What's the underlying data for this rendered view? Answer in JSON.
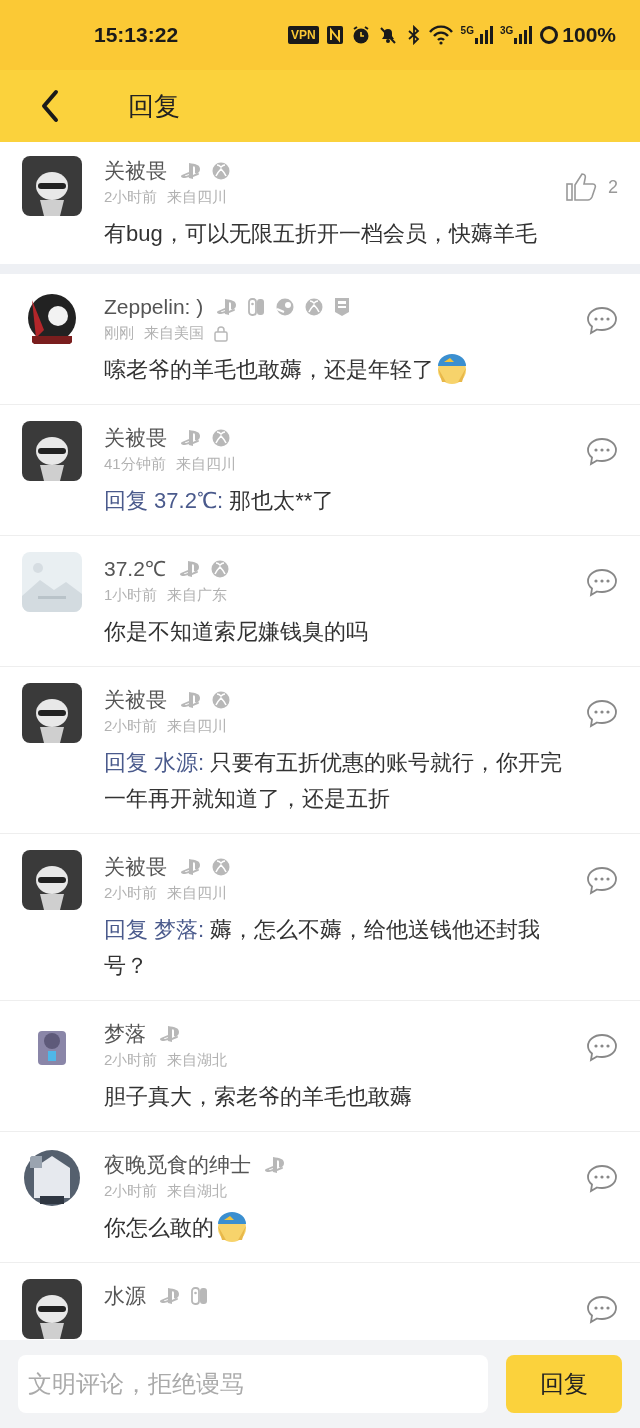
{
  "status_bar": {
    "time": "15:13:22",
    "vpn": "VPN",
    "signal_1": "5G",
    "signal_2": "3G",
    "battery": "100%"
  },
  "header": {
    "title": "回复"
  },
  "main_comment": {
    "author": "关被畏",
    "avatar": {
      "kind": "picture"
    },
    "platforms": [
      {
        "kind": "ps"
      },
      {
        "kind": "xbox"
      }
    ],
    "time": "2小时前",
    "location": "来自四川",
    "text": "有bug，可以无限五折开一档会员，快薅羊毛",
    "likes": "2"
  },
  "replies": [
    {
      "author": "Zeppelin: )",
      "avatar": {
        "kind": "picture"
      },
      "platforms": [
        {
          "kind": "ps"
        },
        {
          "kind": "switch"
        },
        {
          "kind": "steam"
        },
        {
          "kind": "xbox"
        },
        {
          "kind": "epic"
        }
      ],
      "time": "刚刚",
      "location": "来自美国",
      "locked": true,
      "text": "嗦老爷的羊毛也敢薅，还是年轻了",
      "sticker": true
    },
    {
      "author": "关被畏",
      "avatar": {
        "kind": "picture"
      },
      "platforms": [
        {
          "kind": "ps"
        },
        {
          "kind": "xbox"
        }
      ],
      "time": "41分钟前",
      "location": "来自四川",
      "reply_to": "回复 37.2℃:",
      "text": "那也太**了"
    },
    {
      "author": "37.2℃",
      "avatar": {
        "kind": "picture"
      },
      "platforms": [
        {
          "kind": "ps"
        },
        {
          "kind": "xbox"
        }
      ],
      "time": "1小时前",
      "location": "来自广东",
      "text": "你是不知道索尼嫌钱臭的吗"
    },
    {
      "author": "关被畏",
      "avatar": {
        "kind": "picture"
      },
      "platforms": [
        {
          "kind": "ps"
        },
        {
          "kind": "xbox"
        }
      ],
      "time": "2小时前",
      "location": "来自四川",
      "reply_to": "回复 水源:",
      "text": "只要有五折优惠的账号就行，你开完一年再开就知道了，还是五折"
    },
    {
      "author": "关被畏",
      "avatar": {
        "kind": "picture"
      },
      "platforms": [
        {
          "kind": "ps"
        },
        {
          "kind": "xbox"
        }
      ],
      "time": "2小时前",
      "location": "来自四川",
      "reply_to": "回复 梦落:",
      "text": "薅，怎么不薅，给他送钱他还封我号？"
    },
    {
      "author": "梦落",
      "avatar": {
        "kind": "picture"
      },
      "platforms": [
        {
          "kind": "ps"
        }
      ],
      "time": "2小时前",
      "location": "来自湖北",
      "text": "胆子真大，索老爷的羊毛也敢薅"
    },
    {
      "author": "夜晚觅食的绅士",
      "avatar": {
        "kind": "picture"
      },
      "platforms": [
        {
          "kind": "ps"
        }
      ],
      "time": "2小时前",
      "location": "来自湖北",
      "text": "你怎么敢的",
      "sticker": true
    },
    {
      "author": "水源",
      "avatar": {
        "kind": "picture"
      },
      "platforms": [
        {
          "kind": "ps"
        },
        {
          "kind": "switch"
        }
      ]
    }
  ],
  "composer": {
    "placeholder": "文明评论，拒绝谩骂",
    "button": "回复"
  }
}
